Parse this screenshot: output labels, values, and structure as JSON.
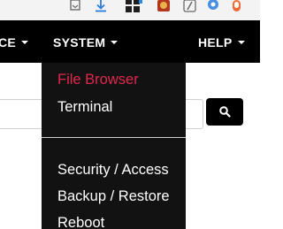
{
  "browser_toolbar": {
    "icons": [
      "bookmark-icon",
      "download-icon",
      "extensions-icon",
      "extension-red-icon",
      "extension-slash-icon",
      "extension-circle-icon",
      "extension-pill-icon"
    ]
  },
  "navbar": {
    "items": [
      {
        "label": "CE",
        "has_caret": true
      },
      {
        "label": "SYSTEM",
        "has_caret": true
      },
      {
        "label": "HELP",
        "has_caret": true
      }
    ]
  },
  "search": {
    "value": "",
    "placeholder": "",
    "button_icon": "search-icon"
  },
  "system_menu": {
    "items": [
      {
        "label": "File Browser",
        "active": true
      },
      {
        "label": "Terminal"
      },
      {
        "label": "Security / Access"
      },
      {
        "label": "Backup / Restore"
      },
      {
        "label": "Reboot"
      }
    ]
  },
  "colors": {
    "navbar_bg": "#000000",
    "menu_bg": "#121212",
    "active_item": "#e0284f",
    "text": "#ffffff"
  }
}
